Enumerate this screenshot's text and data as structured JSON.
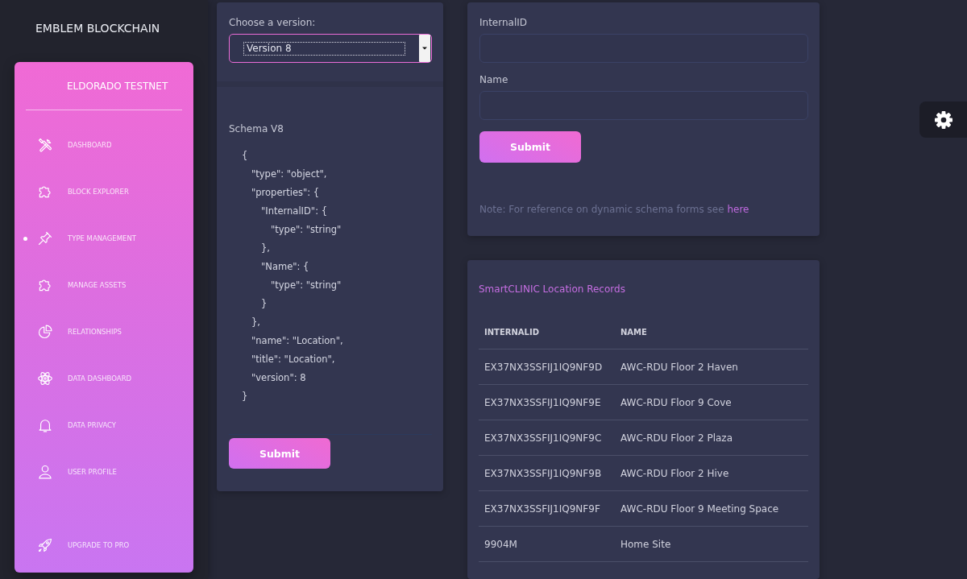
{
  "brand": {
    "title": "EMBLEM BLOCKCHAIN"
  },
  "sidebar": {
    "title": "ELDORADO TESTNET",
    "items": [
      {
        "label": "DASHBOARD",
        "selected": false
      },
      {
        "label": "BLOCK EXPLORER",
        "selected": false
      },
      {
        "label": "TYPE MANAGEMENT",
        "selected": true
      },
      {
        "label": "MANAGE ASSETS",
        "selected": false
      },
      {
        "label": "RELATIONSHIPS",
        "selected": false
      },
      {
        "label": "DATA DASHBOARD",
        "selected": false
      },
      {
        "label": "DATA PRIVACY",
        "selected": false
      },
      {
        "label": "USER PROFILE",
        "selected": false
      }
    ],
    "upgrade": {
      "label": "UPGRADE TO PRO"
    }
  },
  "version_panel": {
    "label": "Choose a version:",
    "select": {
      "value": "Version 8",
      "focused": true
    }
  },
  "schema_panel": {
    "title": "Schema V8",
    "code": [
      {
        "text": "{",
        "children": [
          {
            "text": "\"type\": \"object\","
          },
          {
            "text": "\"properties\": {",
            "children": [
              {
                "text": "\"InternalID\": {",
                "children": [
                  {
                    "text": "\"type\": \"string\""
                  }
                ]
              },
              {
                "text": "},"
              },
              {
                "text": "\"Name\": {",
                "children": [
                  {
                    "text": "\"type\": \"string\""
                  }
                ]
              },
              {
                "text": "}"
              }
            ]
          },
          {
            "text": "},"
          },
          {
            "text": "\"name\": \"Location\","
          },
          {
            "text": "\"title\": \"Location\","
          },
          {
            "text": "\"version\": 8"
          }
        ]
      },
      {
        "text": "}"
      }
    ],
    "submit": "Submit"
  },
  "form_panel": {
    "fields": [
      {
        "label": "InternalID"
      },
      {
        "label": "Name"
      }
    ],
    "submit": "Submit",
    "note": {
      "text": "Note: For reference on dynamic schema forms see",
      "link": "here"
    }
  },
  "records_panel": {
    "title": "SmartCLINIC Location Records",
    "columns": [
      "INTERNALID",
      "NAME"
    ],
    "rows": [
      [
        "EX37NX3SSFIJ1IQ9NF9D",
        "AWC-RDU Floor 2 Haven"
      ],
      [
        "EX37NX3SSFIJ1IQ9NF9E",
        "AWC-RDU Floor 9 Cove"
      ],
      [
        "EX37NX3SSFIJ1IQ9NF9C",
        "AWC-RDU Floor 2 Plaza"
      ],
      [
        "EX37NX3SSFIJ1IQ9NF9B",
        "AWC-RDU Floor 2 Hive"
      ],
      [
        "EX37NX3SSFIJ1IQ9NF9F",
        "AWC-RDU Floor 9 Meeting Space"
      ],
      [
        "9904M",
        "Home Site"
      ]
    ]
  }
}
